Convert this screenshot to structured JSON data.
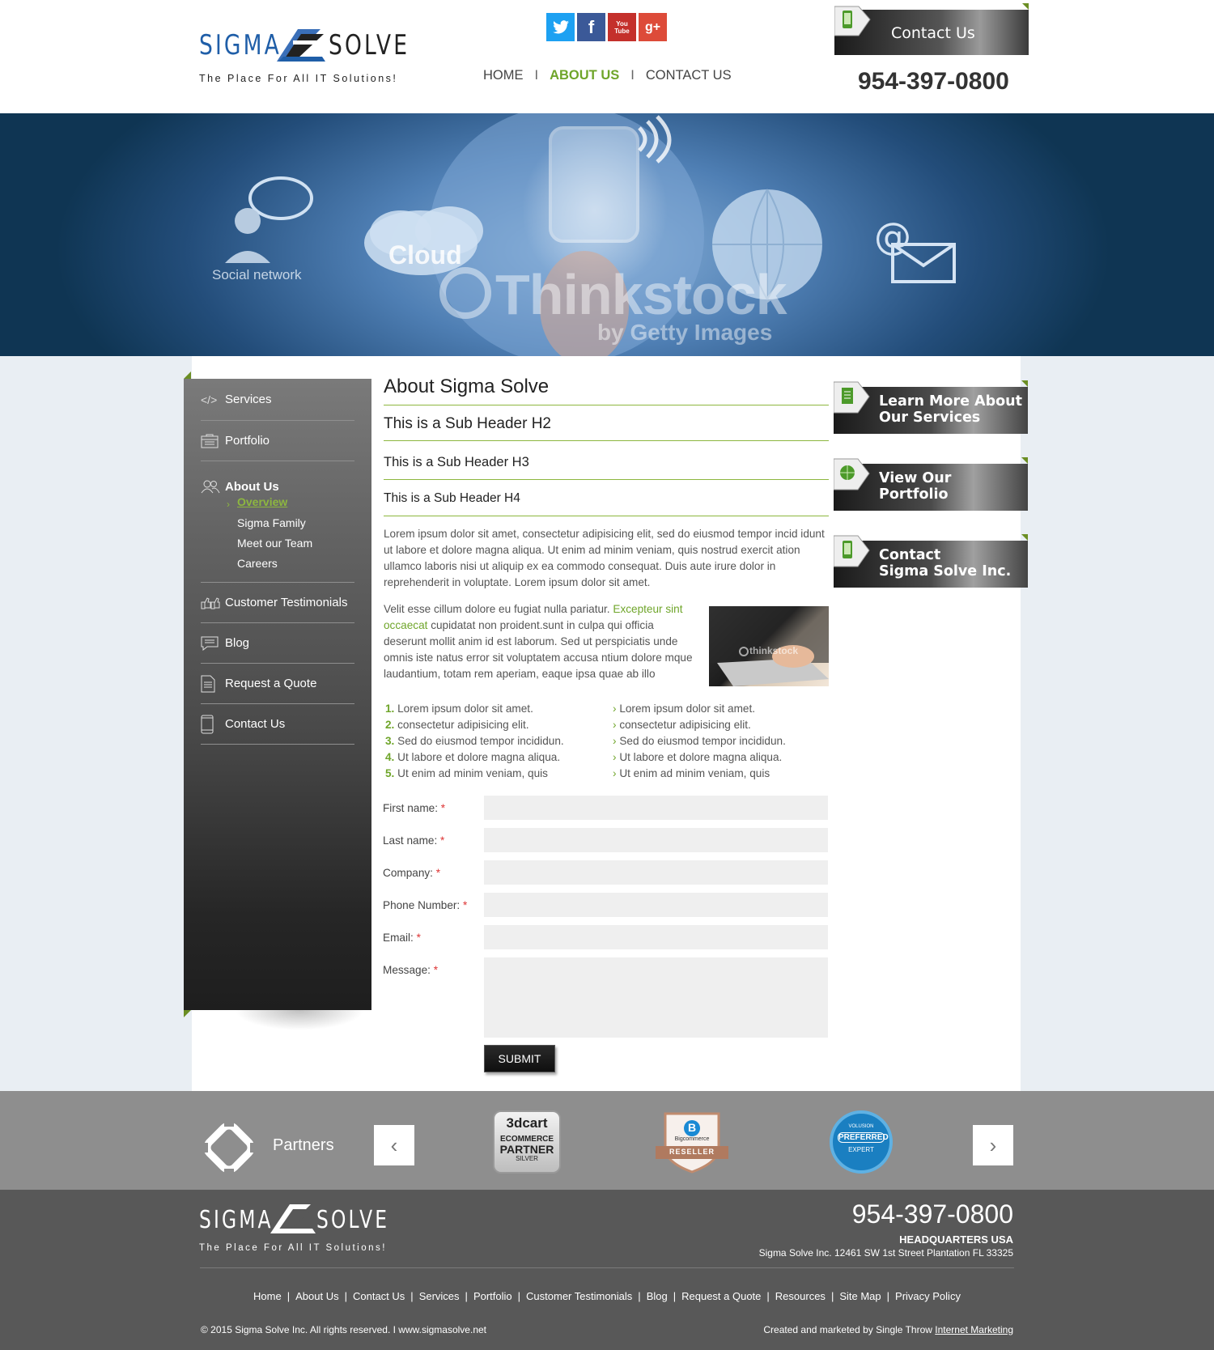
{
  "header": {
    "logo_left": "SIGMA",
    "logo_right": "SOLVE",
    "tagline": "The Place For All IT Solutions!",
    "social": [
      "twitter-icon",
      "facebook-icon",
      "youtube-icon",
      "google-plus-icon"
    ],
    "social_text": {
      "facebook": "f",
      "youtube": "You Tube",
      "google_plus": "g+"
    },
    "nav": [
      {
        "label": "HOME",
        "active": false
      },
      {
        "label": "ABOUT US",
        "active": true
      },
      {
        "label": "CONTACT US",
        "active": false
      }
    ],
    "nav_separator": "I",
    "contact_button": "Contact Us",
    "phone": "954-397-0800"
  },
  "hero": {
    "labels": {
      "social": "Social network",
      "cloud": "Cloud"
    },
    "watermark": "Thinkstock",
    "watermark_sub": "by Getty Images"
  },
  "sidebar": {
    "items": [
      {
        "label": "Services",
        "icon": "code-icon"
      },
      {
        "label": "Portfolio",
        "icon": "portfolio-icon"
      },
      {
        "label": "About Us",
        "icon": "people-icon"
      },
      {
        "label": "Customer Testimonials",
        "icon": "thumbs-up-icon"
      },
      {
        "label": "Blog",
        "icon": "chat-icon"
      },
      {
        "label": "Request a Quote",
        "icon": "document-icon"
      },
      {
        "label": "Contact Us",
        "icon": "phone-icon"
      }
    ],
    "about_icon_text": "</>",
    "sub_items": [
      "Overview",
      "Sigma Family",
      "Meet our Team",
      "Careers"
    ]
  },
  "content": {
    "h1": "About Sigma Solve",
    "h2": "This is a Sub Header H2",
    "h3": "This is a Sub Header H3",
    "h4": "This is a Sub Header H4",
    "para1": "Lorem ipsum dolor sit amet, consectetur adipisicing elit, sed do eiusmod tempor incid idunt ut labore et dolore magna aliqua. Ut enim ad minim veniam, quis nostrud exercit ation ullamco laboris nisi ut aliquip ex ea commodo consequat. Duis aute irure dolor in reprehenderit in voluptate. Lorem ipsum dolor sit amet.",
    "para2_a": "Velit esse cillum dolore eu fugiat nulla pariatur. ",
    "para2_link": "Excepteur sint occaecat",
    "para2_b": " cupidatat non proident.sunt in culpa qui officia deserunt mollit anim id est laborum. Sed ut perspiciatis unde omnis iste natus error sit voluptatem accusa ntium dolore mque laudantium, totam rem aperiam, eaque ipsa quae ab illo",
    "image_watermark": "thinkstock",
    "ordered_list": [
      {
        "num": "1.",
        "text": "Lorem ipsum dolor sit amet."
      },
      {
        "num": "2.",
        "text": "consectetur adipisicing elit."
      },
      {
        "num": "3.",
        "text": "Sed do eiusmod tempor incididun."
      },
      {
        "num": "4.",
        "text": "Ut labore et dolore magna aliqua."
      },
      {
        "num": "5.",
        "text": "Ut enim ad minim veniam, quis"
      }
    ],
    "bullet_list": [
      "Lorem ipsum dolor sit amet.",
      "consectetur adipisicing elit.",
      "Sed do eiusmod tempor incididun.",
      "Ut labore et dolore magna aliqua.",
      "Ut enim ad minim veniam, quis"
    ]
  },
  "form": {
    "fields": [
      {
        "label": "First name:",
        "value": ""
      },
      {
        "label": "Last name:",
        "value": ""
      },
      {
        "label": "Company:",
        "value": ""
      },
      {
        "label": "Phone Number:",
        "value": ""
      },
      {
        "label": "Email:",
        "value": ""
      },
      {
        "label": "Message:",
        "value": ""
      }
    ],
    "required_mark": "*",
    "submit": "SUBMIT"
  },
  "right_buttons": [
    {
      "line1": "Learn More About",
      "line2": "Our Services",
      "icon": "services-doc-icon"
    },
    {
      "line1": "View Our",
      "line2": "Portfolio",
      "icon": "globe-icon"
    },
    {
      "line1": "Contact",
      "line2": "Sigma Solve Inc.",
      "icon": "phone-icon"
    }
  ],
  "partners": {
    "title": "Partners",
    "logos": [
      {
        "name": "3dcart-badge",
        "lines": [
          "3dcart",
          "ECOMMERCE",
          "PARTNER",
          "SILVER"
        ]
      },
      {
        "name": "bigcommerce-badge",
        "lines": [
          "B",
          "Bigcommerce",
          "RESELLER"
        ]
      },
      {
        "name": "volusion-badge",
        "lines": [
          "VOLUSION",
          "PREFERRED",
          "EXPERT"
        ]
      }
    ],
    "prev": "‹",
    "next": "›"
  },
  "footer": {
    "logo_left": "SIGMA",
    "logo_right": "SOLVE",
    "tagline": "The Place For All IT Solutions!",
    "phone": "954-397-0800",
    "hq_title": "HEADQUARTERS USA",
    "address": "Sigma Solve Inc. 12461 SW 1st Street Plantation FL 33325",
    "links": [
      "Home",
      "About Us",
      "Contact Us",
      "Services",
      "Portfolio",
      "Customer Testimonials",
      "Blog",
      "Request a Quote",
      "Resources",
      "Site Map",
      "Privacy Policy"
    ],
    "copyright": "© 2015 Sigma Solve Inc. All rights reserved. I www.sigmasolve.net",
    "credit_prefix": "Created and marketed by Single Throw ",
    "credit_link": "Internet Marketing"
  },
  "colors": {
    "accent_green": "#6fa52a",
    "brand_blue": "#1f5ea8",
    "twitter": "#1da1f2",
    "facebook": "#3b5998",
    "youtube": "#c4302b",
    "google_plus": "#dd4b39"
  }
}
